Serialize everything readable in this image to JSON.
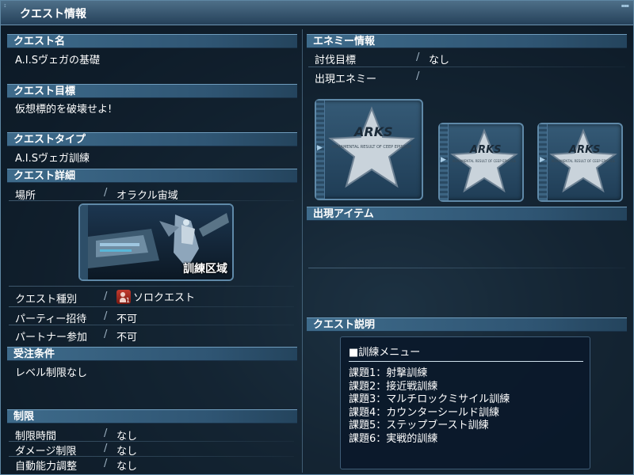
{
  "window": {
    "title": "クエスト情報"
  },
  "left": {
    "quest_name": {
      "header": "クエスト名",
      "value": "A.I.Sヴェガの基礎"
    },
    "quest_goal": {
      "header": "クエスト目標",
      "value": "仮想標的を破壊せよ!"
    },
    "quest_type": {
      "header": "クエストタイプ",
      "value": "A.I.Sヴェガ訓練"
    },
    "quest_detail": {
      "header": "クエスト詳細",
      "location_label": "場所",
      "location_value": "オラクル宙域",
      "area_image_label": "訓練区域",
      "rows": [
        {
          "label": "クエスト種別",
          "value": "ソロクエスト",
          "badge": "1"
        },
        {
          "label": "パーティー招待",
          "value": "不可"
        },
        {
          "label": "パートナー参加",
          "value": "不可"
        }
      ]
    },
    "requirements": {
      "header": "受注条件",
      "value": "レベル制限なし"
    },
    "limits": {
      "header": "制限",
      "rows": [
        {
          "label": "制限時間",
          "value": "なし"
        },
        {
          "label": "ダメージ制限",
          "value": "なし"
        },
        {
          "label": "自動能力調整",
          "value": "なし"
        }
      ]
    }
  },
  "right": {
    "enemy_info": {
      "header": "エネミー情報",
      "target_label": "討伐目標",
      "target_value": "なし",
      "appear_label": "出現エネミー",
      "appear_value": "",
      "cards": [
        {
          "logo": "ARKS",
          "text": "ARMAMENTAL RESULT OF CEEP EPISODE"
        },
        {
          "logo": "ARKS",
          "text": "ARMAMENTAL RESULT OF CEEP EPISODE"
        },
        {
          "logo": "ARKS",
          "text": "ARMAMENTAL RESULT OF CEEP EPISODE"
        }
      ]
    },
    "items": {
      "header": "出現アイテム"
    },
    "description": {
      "header": "クエスト説明",
      "title": "■訓練メニュー",
      "lines": [
        "課題1：射撃訓練",
        "課題2：接近戦訓練",
        "課題3：マルチロックミサイル訓練",
        "課題4：カウンターシールド訓練",
        "課題5：ステップブースト訓練",
        "課題6：実戦的訓練"
      ]
    }
  },
  "colors": {
    "header_blue": "#3e6b8b",
    "frame_border": "#5f89a8",
    "badge_red": "#c23a2e"
  },
  "icons": {
    "solo_badge": "solo-quest-icon",
    "enemy_logo": "star-emblem-icon"
  }
}
